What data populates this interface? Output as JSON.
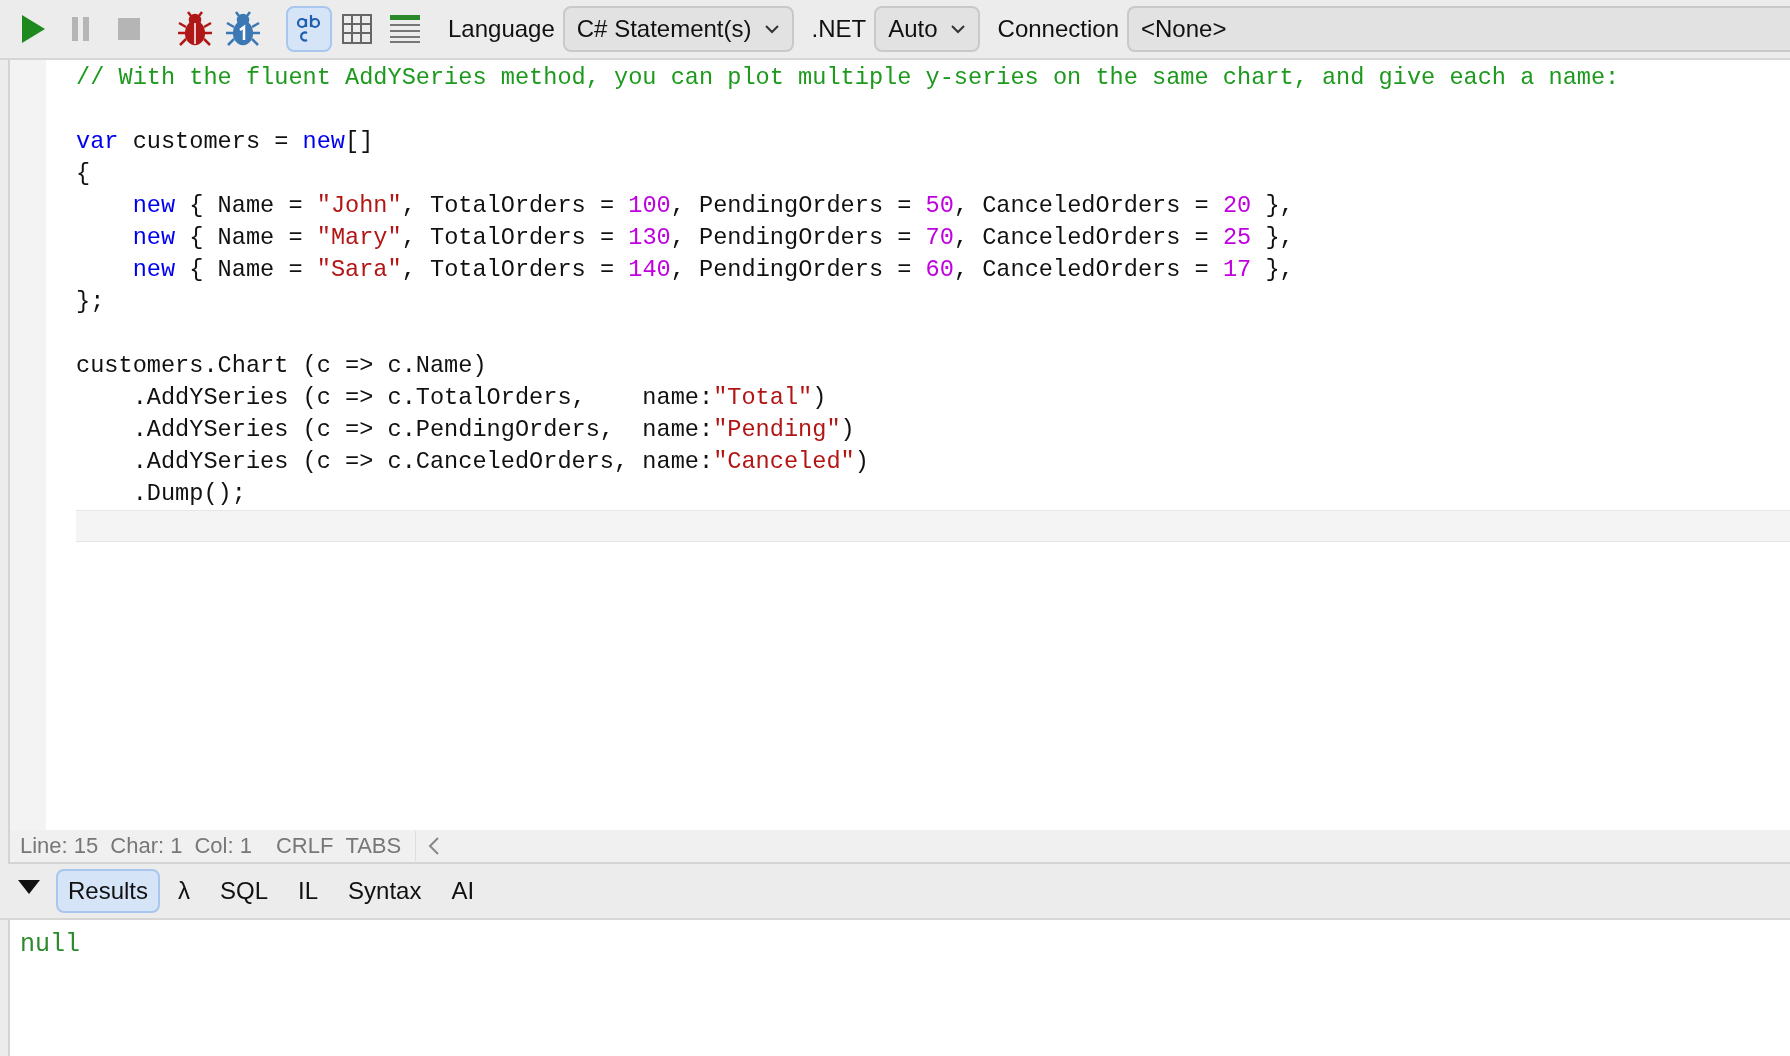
{
  "toolbar": {
    "buttons": [
      {
        "kind": "run",
        "disabled": false,
        "selected": false
      },
      {
        "kind": "pause",
        "disabled": true,
        "selected": false
      },
      {
        "kind": "stop",
        "disabled": true,
        "selected": false
      },
      {
        "kind": "bug",
        "disabled": false,
        "selected": false
      },
      {
        "kind": "bug-one",
        "disabled": false,
        "selected": false
      },
      {
        "kind": "text-results",
        "disabled": false,
        "selected": true
      },
      {
        "kind": "grid-results",
        "disabled": false,
        "selected": false
      },
      {
        "kind": "rows",
        "disabled": false,
        "selected": false
      }
    ],
    "language": {
      "label": "Language",
      "value": "C# Statement(s)"
    },
    "dotnet": {
      "label": ".NET",
      "value": "Auto"
    },
    "connection": {
      "label": "Connection",
      "value": "<None>"
    }
  },
  "editor": {
    "lines": [
      {
        "current": false,
        "tokens": [
          {
            "kind": "comment",
            "text": "// With the fluent AddYSeries method, you can plot multiple y-series on the same chart, and give each a name:"
          }
        ]
      },
      {
        "current": false
      },
      {
        "current": false,
        "tokens": [
          {
            "kind": "keyword",
            "text": "var"
          },
          {
            "kind": "plain",
            "text": " customers = "
          },
          {
            "kind": "keyword",
            "text": "new"
          },
          {
            "kind": "plain",
            "text": "[]"
          }
        ]
      },
      {
        "current": false,
        "tokens": [
          {
            "kind": "plain",
            "text": "{"
          }
        ]
      },
      {
        "current": false,
        "tokens": [
          {
            "kind": "keyword",
            "text": "    new"
          },
          {
            "kind": "plain",
            "text": " { Name = "
          },
          {
            "kind": "string",
            "text": "\"John\""
          },
          {
            "kind": "plain",
            "text": ", TotalOrders = "
          },
          {
            "kind": "number",
            "text": "100"
          },
          {
            "kind": "plain",
            "text": ", PendingOrders = "
          },
          {
            "kind": "number",
            "text": "50"
          },
          {
            "kind": "plain",
            "text": ", CanceledOrders = "
          },
          {
            "kind": "number",
            "text": "20"
          },
          {
            "kind": "plain",
            "text": " },"
          }
        ]
      },
      {
        "current": false,
        "tokens": [
          {
            "kind": "keyword",
            "text": "    new"
          },
          {
            "kind": "plain",
            "text": " { Name = "
          },
          {
            "kind": "string",
            "text": "\"Mary\""
          },
          {
            "kind": "plain",
            "text": ", TotalOrders = "
          },
          {
            "kind": "number",
            "text": "130"
          },
          {
            "kind": "plain",
            "text": ", PendingOrders = "
          },
          {
            "kind": "number",
            "text": "70"
          },
          {
            "kind": "plain",
            "text": ", CanceledOrders = "
          },
          {
            "kind": "number",
            "text": "25"
          },
          {
            "kind": "plain",
            "text": " },"
          }
        ]
      },
      {
        "current": false,
        "tokens": [
          {
            "kind": "keyword",
            "text": "    new"
          },
          {
            "kind": "plain",
            "text": " { Name = "
          },
          {
            "kind": "string",
            "text": "\"Sara\""
          },
          {
            "kind": "plain",
            "text": ", TotalOrders = "
          },
          {
            "kind": "number",
            "text": "140"
          },
          {
            "kind": "plain",
            "text": ", PendingOrders = "
          },
          {
            "kind": "number",
            "text": "60"
          },
          {
            "kind": "plain",
            "text": ", CanceledOrders = "
          },
          {
            "kind": "number",
            "text": "17"
          },
          {
            "kind": "plain",
            "text": " },"
          }
        ]
      },
      {
        "current": false,
        "tokens": [
          {
            "kind": "plain",
            "text": "};"
          }
        ]
      },
      {
        "current": false
      },
      {
        "current": false,
        "tokens": [
          {
            "kind": "plain",
            "text": "customers.Chart (c => c.Name)"
          }
        ]
      },
      {
        "current": false,
        "tokens": [
          {
            "kind": "plain",
            "text": "    .AddYSeries (c => c.TotalOrders,    name:"
          },
          {
            "kind": "string",
            "text": "\"Total\""
          },
          {
            "kind": "plain",
            "text": ")"
          }
        ]
      },
      {
        "current": false,
        "tokens": [
          {
            "kind": "plain",
            "text": "    .AddYSeries (c => c.PendingOrders,  name:"
          },
          {
            "kind": "string",
            "text": "\"Pending\""
          },
          {
            "kind": "plain",
            "text": ")"
          }
        ]
      },
      {
        "current": false,
        "tokens": [
          {
            "kind": "plain",
            "text": "    .AddYSeries (c => c.CanceledOrders, name:"
          },
          {
            "kind": "string",
            "text": "\"Canceled\""
          },
          {
            "kind": "plain",
            "text": ")"
          }
        ]
      },
      {
        "current": false,
        "tokens": [
          {
            "kind": "plain",
            "text": "    .Dump();"
          }
        ]
      },
      {
        "current": true
      }
    ]
  },
  "status_bar": {
    "items": [
      "Line: 15",
      "Char: 1",
      "Col: 1",
      "CRLF",
      "TABS"
    ]
  },
  "results": {
    "expanded": true,
    "tabs": [
      {
        "label": "Results",
        "selected": true
      },
      {
        "label": "λ",
        "selected": false
      },
      {
        "label": "SQL",
        "selected": false
      },
      {
        "label": "IL",
        "selected": false
      },
      {
        "label": "Syntax",
        "selected": false
      },
      {
        "label": "AI",
        "selected": false
      }
    ],
    "output": "null"
  }
}
